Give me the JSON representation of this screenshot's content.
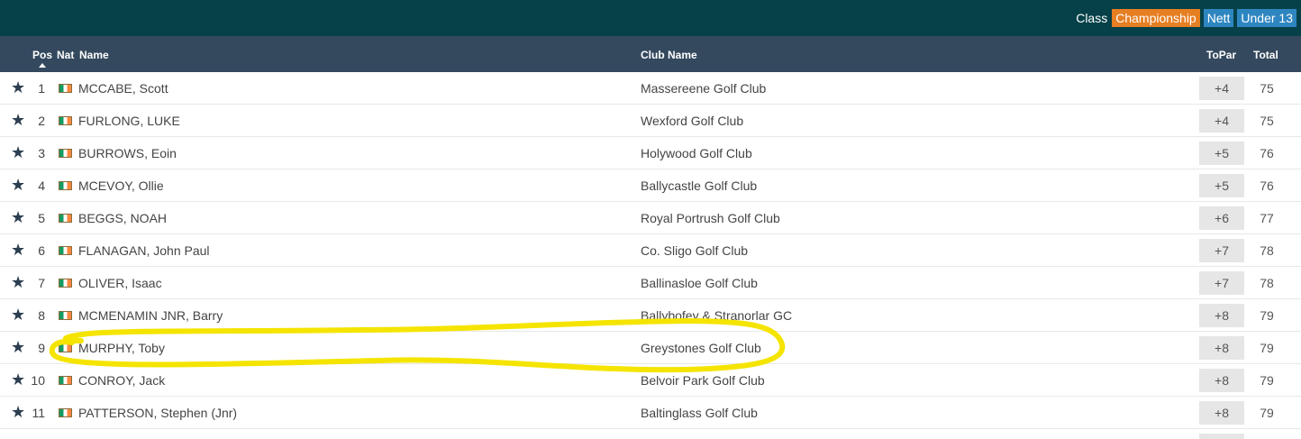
{
  "filter": {
    "label": "Class",
    "options": [
      "Championship",
      "Nett",
      "Under 13"
    ],
    "selected": "Championship"
  },
  "columns": {
    "pos": "Pos",
    "nat": "Nat",
    "name": "Name",
    "club": "Club Name",
    "topar": "ToPar",
    "total": "Total"
  },
  "rows": [
    {
      "pos": "1",
      "name": "MCCABE, Scott",
      "club": "Massereene Golf Club",
      "topar": "+4",
      "total": "75"
    },
    {
      "pos": "2",
      "name": "FURLONG, LUKE",
      "club": "Wexford Golf Club",
      "topar": "+4",
      "total": "75"
    },
    {
      "pos": "3",
      "name": "BURROWS, Eoin",
      "club": "Holywood Golf Club",
      "topar": "+5",
      "total": "76"
    },
    {
      "pos": "4",
      "name": "MCEVOY, Ollie",
      "club": "Ballycastle Golf Club",
      "topar": "+5",
      "total": "76"
    },
    {
      "pos": "5",
      "name": "BEGGS, NOAH",
      "club": "Royal Portrush Golf Club",
      "topar": "+6",
      "total": "77"
    },
    {
      "pos": "6",
      "name": "FLANAGAN, John Paul",
      "club": "Co. Sligo Golf Club",
      "topar": "+7",
      "total": "78"
    },
    {
      "pos": "7",
      "name": "OLIVER, Isaac",
      "club": "Ballinasloe Golf Club",
      "topar": "+7",
      "total": "78"
    },
    {
      "pos": "8",
      "name": "MCMENAMIN JNR, Barry",
      "club": "Ballybofey & Stranorlar GC",
      "topar": "+8",
      "total": "79"
    },
    {
      "pos": "9",
      "name": "MURPHY, Toby",
      "club": "Greystones Golf Club",
      "topar": "+8",
      "total": "79"
    },
    {
      "pos": "10",
      "name": "CONROY, Jack",
      "club": "Belvoir Park Golf Club",
      "topar": "+8",
      "total": "79"
    },
    {
      "pos": "11",
      "name": "PATTERSON, Stephen (Jnr)",
      "club": "Baltinglass Golf Club",
      "topar": "+8",
      "total": "79"
    }
  ],
  "icons": {
    "favorite": "star-icon",
    "nationality": "ireland-flag-icon",
    "sort": "sort-ascending-icon"
  },
  "colors": {
    "topbar": "#064149",
    "header": "#34495e",
    "championship": "#e67e22",
    "nett": "#2e86c1",
    "under13": "#2e86c1",
    "annotation": "#f5e400"
  }
}
